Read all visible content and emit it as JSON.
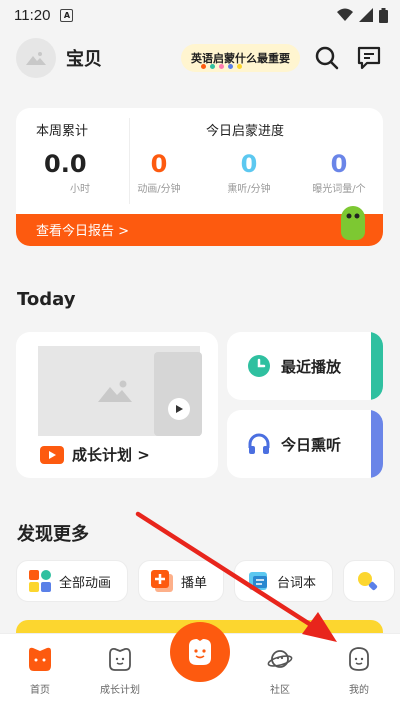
{
  "status_bar": {
    "time": "11:20",
    "notif_letter": "A"
  },
  "header": {
    "username": "宝贝",
    "promo_text": "英语启蒙什么最重要",
    "promo_dot_colors": [
      "#fd5a0f",
      "#2fc0a0",
      "#ff7bb0",
      "#5a80e8",
      "#fcd62f"
    ]
  },
  "stats": {
    "week_title": "本周累计",
    "week_value": "0.0",
    "week_unit": "小时",
    "today_title": "今日启蒙进度",
    "items": [
      {
        "value": "0",
        "label": "动画/分钟",
        "color": "#fd5a0f"
      },
      {
        "value": "0",
        "label": "熏听/分钟",
        "color": "#5cc8f0"
      },
      {
        "value": "0",
        "label": "曝光词量/个",
        "color": "#6a85e8"
      }
    ],
    "report_link": "查看今日报告 >"
  },
  "today": {
    "title": "Today",
    "growth_label": "成长计划 >",
    "recent_label": "最近播放",
    "listen_label": "今日熏听",
    "recent_accent": "#2fc0a0",
    "listen_accent": "#6a85e8"
  },
  "discover": {
    "title": "发现更多",
    "chips": [
      {
        "label": "全部动画",
        "icon": "grid-icon"
      },
      {
        "label": "播单",
        "icon": "playlist-icon"
      },
      {
        "label": "台词本",
        "icon": "script-book-icon"
      }
    ]
  },
  "tabbar": {
    "items": [
      {
        "label": "首页",
        "icon": "home-icon"
      },
      {
        "label": "成长计划",
        "icon": "growth-icon"
      },
      {
        "label": "",
        "icon": "center-play-icon"
      },
      {
        "label": "社区",
        "icon": "planet-icon"
      },
      {
        "label": "我的",
        "icon": "profile-icon"
      }
    ]
  },
  "colors": {
    "brand_orange": "#fd5a0f",
    "annotation_red": "#e8251c"
  }
}
